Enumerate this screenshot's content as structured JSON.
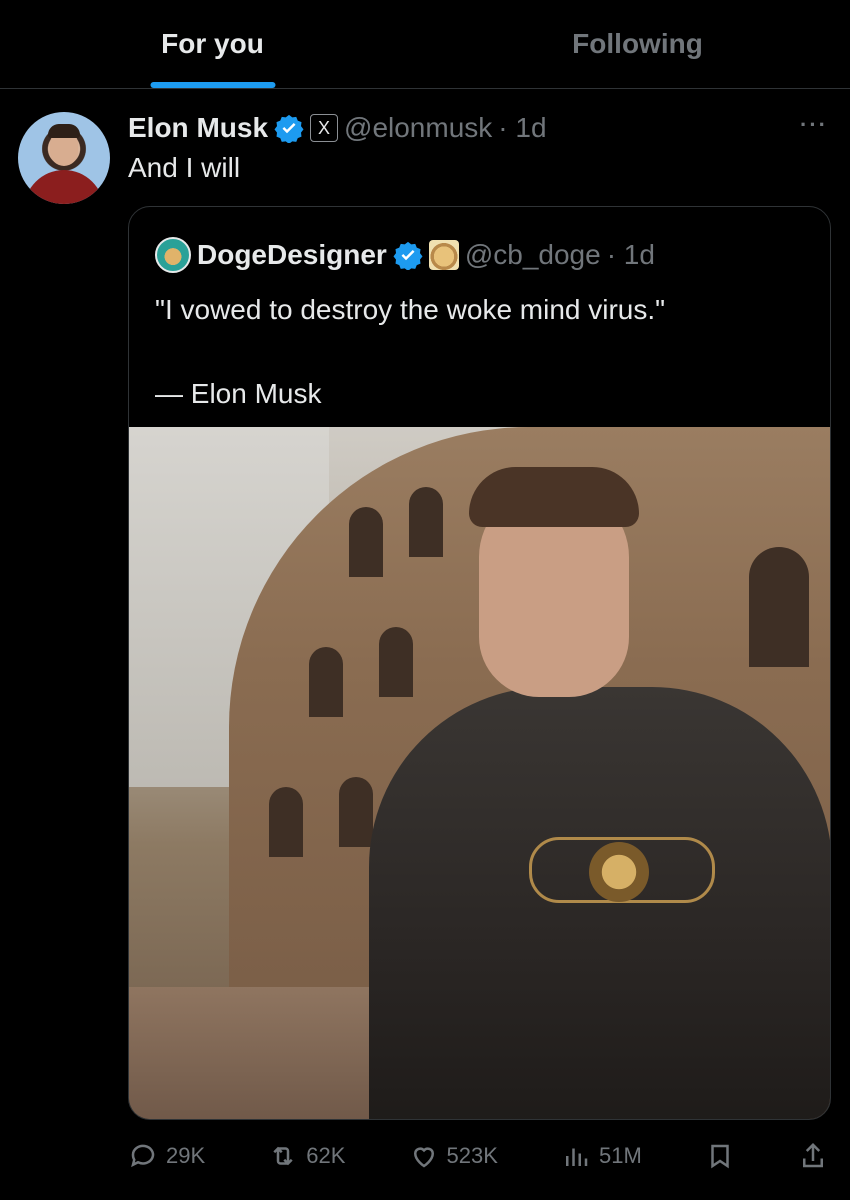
{
  "tabs": [
    {
      "label": "For you",
      "active": true
    },
    {
      "label": "Following",
      "active": false
    }
  ],
  "tweet": {
    "author_name": "Elon Musk",
    "affiliation_badge": "X",
    "handle": "@elonmusk",
    "time": "· 1d",
    "text": "And I will",
    "quote": {
      "author_name": "DogeDesigner",
      "handle": "@cb_doge",
      "time": "· 1d",
      "text": "\"I vowed to destroy the woke mind virus.\"\n\n— Elon Musk"
    },
    "stats": {
      "replies": "29K",
      "reposts": "62K",
      "likes": "523K",
      "views": "51M"
    }
  },
  "colors": {
    "accent": "#1d9bf0",
    "muted": "#71767b",
    "text": "#e7e9ea",
    "background": "#000000",
    "border": "#2f3336"
  },
  "icons": [
    "verified-badge-icon",
    "x-logo-icon",
    "doge-badge-icon",
    "more-icon",
    "reply-icon",
    "repost-icon",
    "like-icon",
    "views-icon",
    "bookmark-icon",
    "share-icon"
  ]
}
